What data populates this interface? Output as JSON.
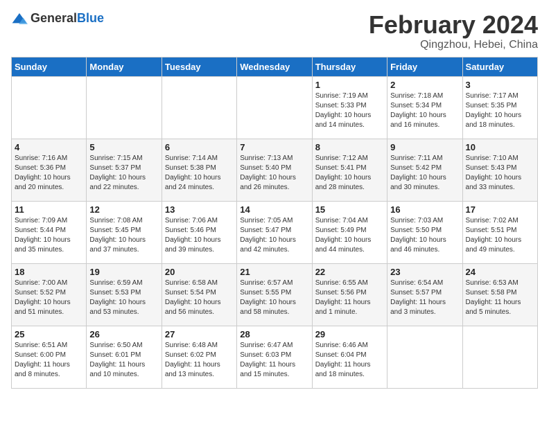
{
  "logo": {
    "general": "General",
    "blue": "Blue"
  },
  "title": "February 2024",
  "subtitle": "Qingzhou, Hebei, China",
  "days_header": [
    "Sunday",
    "Monday",
    "Tuesday",
    "Wednesday",
    "Thursday",
    "Friday",
    "Saturday"
  ],
  "weeks": [
    [
      {
        "day": "",
        "info": ""
      },
      {
        "day": "",
        "info": ""
      },
      {
        "day": "",
        "info": ""
      },
      {
        "day": "",
        "info": ""
      },
      {
        "day": "1",
        "info": "Sunrise: 7:19 AM\nSunset: 5:33 PM\nDaylight: 10 hours\nand 14 minutes."
      },
      {
        "day": "2",
        "info": "Sunrise: 7:18 AM\nSunset: 5:34 PM\nDaylight: 10 hours\nand 16 minutes."
      },
      {
        "day": "3",
        "info": "Sunrise: 7:17 AM\nSunset: 5:35 PM\nDaylight: 10 hours\nand 18 minutes."
      }
    ],
    [
      {
        "day": "4",
        "info": "Sunrise: 7:16 AM\nSunset: 5:36 PM\nDaylight: 10 hours\nand 20 minutes."
      },
      {
        "day": "5",
        "info": "Sunrise: 7:15 AM\nSunset: 5:37 PM\nDaylight: 10 hours\nand 22 minutes."
      },
      {
        "day": "6",
        "info": "Sunrise: 7:14 AM\nSunset: 5:38 PM\nDaylight: 10 hours\nand 24 minutes."
      },
      {
        "day": "7",
        "info": "Sunrise: 7:13 AM\nSunset: 5:40 PM\nDaylight: 10 hours\nand 26 minutes."
      },
      {
        "day": "8",
        "info": "Sunrise: 7:12 AM\nSunset: 5:41 PM\nDaylight: 10 hours\nand 28 minutes."
      },
      {
        "day": "9",
        "info": "Sunrise: 7:11 AM\nSunset: 5:42 PM\nDaylight: 10 hours\nand 30 minutes."
      },
      {
        "day": "10",
        "info": "Sunrise: 7:10 AM\nSunset: 5:43 PM\nDaylight: 10 hours\nand 33 minutes."
      }
    ],
    [
      {
        "day": "11",
        "info": "Sunrise: 7:09 AM\nSunset: 5:44 PM\nDaylight: 10 hours\nand 35 minutes."
      },
      {
        "day": "12",
        "info": "Sunrise: 7:08 AM\nSunset: 5:45 PM\nDaylight: 10 hours\nand 37 minutes."
      },
      {
        "day": "13",
        "info": "Sunrise: 7:06 AM\nSunset: 5:46 PM\nDaylight: 10 hours\nand 39 minutes."
      },
      {
        "day": "14",
        "info": "Sunrise: 7:05 AM\nSunset: 5:47 PM\nDaylight: 10 hours\nand 42 minutes."
      },
      {
        "day": "15",
        "info": "Sunrise: 7:04 AM\nSunset: 5:49 PM\nDaylight: 10 hours\nand 44 minutes."
      },
      {
        "day": "16",
        "info": "Sunrise: 7:03 AM\nSunset: 5:50 PM\nDaylight: 10 hours\nand 46 minutes."
      },
      {
        "day": "17",
        "info": "Sunrise: 7:02 AM\nSunset: 5:51 PM\nDaylight: 10 hours\nand 49 minutes."
      }
    ],
    [
      {
        "day": "18",
        "info": "Sunrise: 7:00 AM\nSunset: 5:52 PM\nDaylight: 10 hours\nand 51 minutes."
      },
      {
        "day": "19",
        "info": "Sunrise: 6:59 AM\nSunset: 5:53 PM\nDaylight: 10 hours\nand 53 minutes."
      },
      {
        "day": "20",
        "info": "Sunrise: 6:58 AM\nSunset: 5:54 PM\nDaylight: 10 hours\nand 56 minutes."
      },
      {
        "day": "21",
        "info": "Sunrise: 6:57 AM\nSunset: 5:55 PM\nDaylight: 10 hours\nand 58 minutes."
      },
      {
        "day": "22",
        "info": "Sunrise: 6:55 AM\nSunset: 5:56 PM\nDaylight: 11 hours\nand 1 minute."
      },
      {
        "day": "23",
        "info": "Sunrise: 6:54 AM\nSunset: 5:57 PM\nDaylight: 11 hours\nand 3 minutes."
      },
      {
        "day": "24",
        "info": "Sunrise: 6:53 AM\nSunset: 5:58 PM\nDaylight: 11 hours\nand 5 minutes."
      }
    ],
    [
      {
        "day": "25",
        "info": "Sunrise: 6:51 AM\nSunset: 6:00 PM\nDaylight: 11 hours\nand 8 minutes."
      },
      {
        "day": "26",
        "info": "Sunrise: 6:50 AM\nSunset: 6:01 PM\nDaylight: 11 hours\nand 10 minutes."
      },
      {
        "day": "27",
        "info": "Sunrise: 6:48 AM\nSunset: 6:02 PM\nDaylight: 11 hours\nand 13 minutes."
      },
      {
        "day": "28",
        "info": "Sunrise: 6:47 AM\nSunset: 6:03 PM\nDaylight: 11 hours\nand 15 minutes."
      },
      {
        "day": "29",
        "info": "Sunrise: 6:46 AM\nSunset: 6:04 PM\nDaylight: 11 hours\nand 18 minutes."
      },
      {
        "day": "",
        "info": ""
      },
      {
        "day": "",
        "info": ""
      }
    ]
  ]
}
